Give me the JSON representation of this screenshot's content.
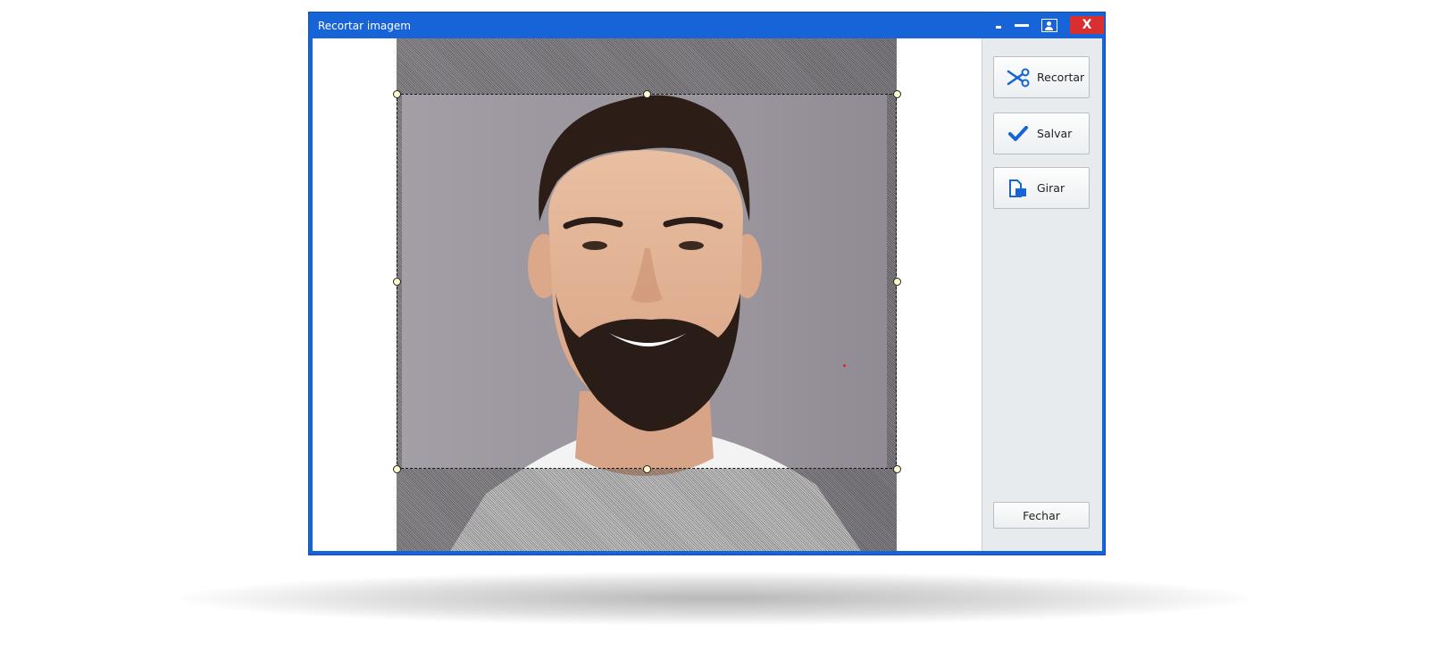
{
  "window": {
    "title": "Recortar imagem",
    "close_label": "X",
    "accent_color": "#1764d8",
    "close_color": "#d9302f"
  },
  "icons": {
    "minimize_small": "minimize-small-icon",
    "minimize": "minimize-icon",
    "user": "user-card-icon",
    "scissors": "scissors-icon",
    "check": "check-icon",
    "rotate": "rotate-icon"
  },
  "sidebar": {
    "recortar_label": "Recortar",
    "salvar_label": "Salvar",
    "girar_label": "Girar",
    "fechar_label": "Fechar"
  }
}
